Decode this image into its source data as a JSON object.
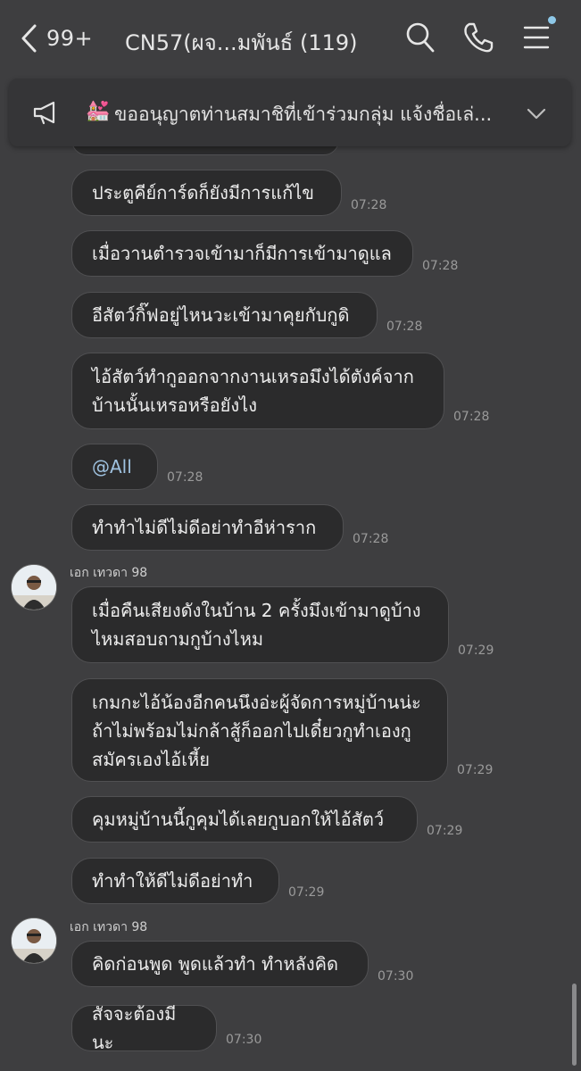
{
  "header": {
    "back_count": "99+",
    "title": "CN57(ผจ...มพันธ์ (119)",
    "icons": [
      "chevron-left-icon",
      "search-icon",
      "phone-icon",
      "menu-icon"
    ]
  },
  "announcement": {
    "text": "ขออนุญาตท่านสมาชิที่เข้าร่วมกลุ่ม แจ้งชื่อเล่...",
    "emoji": "💒"
  },
  "messages": [
    {
      "text": "ประตูคีย์การ์ดก็ยังมีการแก้ไข",
      "time": "07:28"
    },
    {
      "text": "เมื่อวานตำรวจเข้ามาก็มีการเข้ามาดูแล",
      "time": "07:28"
    },
    {
      "text": "อีสัตว์กิ๊ฟอยู่ไหนวะเข้ามาคุยกับกูดิ",
      "time": "07:28"
    },
    {
      "lines": [
        "ไอ้สัตว์ทำกูออกจากงานเหรอมึงได้ตังค์จาก",
        "บ้านนั้นเหรอหรือยังไง"
      ],
      "time": "07:28"
    },
    {
      "text": "@All",
      "time": "07:28"
    },
    {
      "text": "ทำทำไม่ดีไม่ดีอย่าทำอีห่าราก",
      "time": "07:28"
    },
    {
      "sender": "เอก เทวดา 98"
    },
    {
      "lines": [
        "เมื่อคืนเสียงดังในบ้าน 2 ครั้งมึงเข้ามาดูบ้าง",
        "ไหมสอบถามกูบ้างไหม"
      ],
      "time": "07:29"
    },
    {
      "lines": [
        "เกมกะไอ้น้องอีกคนนึงอ่ะผู้จัดการหมู่บ้านน่ะ",
        "ถ้าไม่พร้อมไม่กล้าสู้ก็ออกไปเดี๋ยวกูทำเองกู",
        "สมัครเองไอ้เหี้ย"
      ],
      "time": "07:29"
    },
    {
      "text": "คุมหมู่บ้านนี้กูคุมได้เลยกูบอกให้ไอ้สัตว์",
      "time": "07:29"
    },
    {
      "text": "ทำทำให้ดีไม่ดีอย่าทำ",
      "time": "07:29"
    },
    {
      "sender": "เอก เทวดา 98"
    },
    {
      "text": "คิดก่อนพูด พูดแล้วทำ ทำหลังคิด",
      "time": "07:30"
    },
    {
      "text": "สัจจะต้องมีนะ",
      "time": "07:30"
    }
  ],
  "colors": {
    "background": "#3e3e40",
    "bubble": "#2b2b2c",
    "mention": "#9fc2e0",
    "time": "#9a9a9a"
  }
}
